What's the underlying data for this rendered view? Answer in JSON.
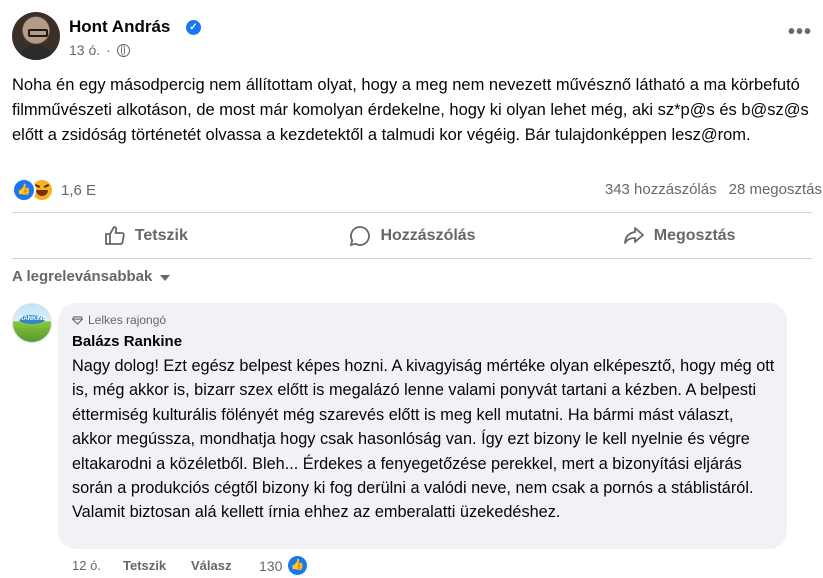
{
  "post": {
    "author": "Hont András",
    "time": "13 ó.",
    "menu_icon": "more-horizontal-icon",
    "text": "Noha én egy másodpercig nem állítottam olyat, hogy a meg nem nevezett művésznő látható a ma körbefutó filmművészeti alkotáson, de most már komolyan érdekelne, hogy ki olyan lehet még, aki sz*p@s és b@sz@s előtt a zsidóság történetét olvassa a kezdetektől a talmudi kor végéig. Bár tulajdonképpen lesz@rom.",
    "reaction_count": "1,6 E",
    "comments_count": "343 hozzászólás",
    "shares_count": "28 megosztás"
  },
  "actions": {
    "like": "Tetszik",
    "comment": "Hozzászólás",
    "share": "Megosztás"
  },
  "sort": {
    "label": "A legrelevánsabbak"
  },
  "comment": {
    "badge": "Lelkes rajongó",
    "author": "Balázs Rankine",
    "avatar_text": "RANKINE",
    "text": "Nagy dolog! Ezt egész belpest képes hozni. A kivagyiság mértéke olyan elképesztő, hogy még ott is, még akkor is, bizarr szex előtt is megalázó lenne valami ponyvát tartani a kézben. A belpesti éttermiség kulturális fölényét még szarevés előtt is meg kell mutatni. Ha bármi mást választ, akkor megússza, mondhatja hogy csak hasonlóság van. Így ezt bizony le kell nyelnie és végre eltakarodni a közéletből. Bleh... Érdekes a fenyegetőzése perekkel, mert a bizonyítási eljárás során a produkciós cégtől bizony ki fog derülni a valódi neve, nem csak a pornós a stáblistáról. Valamit biztosan alá kellett írnia ehhez az emberalatti üzekedéshez.",
    "time": "12 ó.",
    "like": "Tetszik",
    "reply": "Válasz",
    "like_count": "130"
  },
  "colors": {
    "brand_blue": "#1877f2",
    "secondary_text": "#65676b",
    "bubble_bg": "#f0f2f5"
  }
}
